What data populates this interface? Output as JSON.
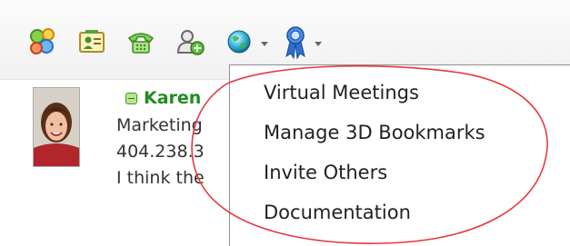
{
  "toolbar": {
    "buttons": [
      {
        "icon": "contacts-icon"
      },
      {
        "icon": "business-card-icon"
      },
      {
        "icon": "phone-icon"
      },
      {
        "icon": "add-contact-icon"
      },
      {
        "icon": "globe-icon",
        "has_dropdown": true
      },
      {
        "icon": "ribbon-award-icon",
        "has_dropdown": true
      }
    ]
  },
  "contact": {
    "name": "Karen",
    "status": "available",
    "title_partial": "Marketing",
    "phone_partial": "404.238.3",
    "note_partial": "I think the"
  },
  "menu": {
    "items": [
      "Virtual Meetings",
      "Manage 3D Bookmarks",
      "Invite Others",
      "Documentation"
    ]
  },
  "colors": {
    "annotation_red": "#e8383d",
    "name_green": "#218d21",
    "menu_border": "#8f8f8f"
  }
}
